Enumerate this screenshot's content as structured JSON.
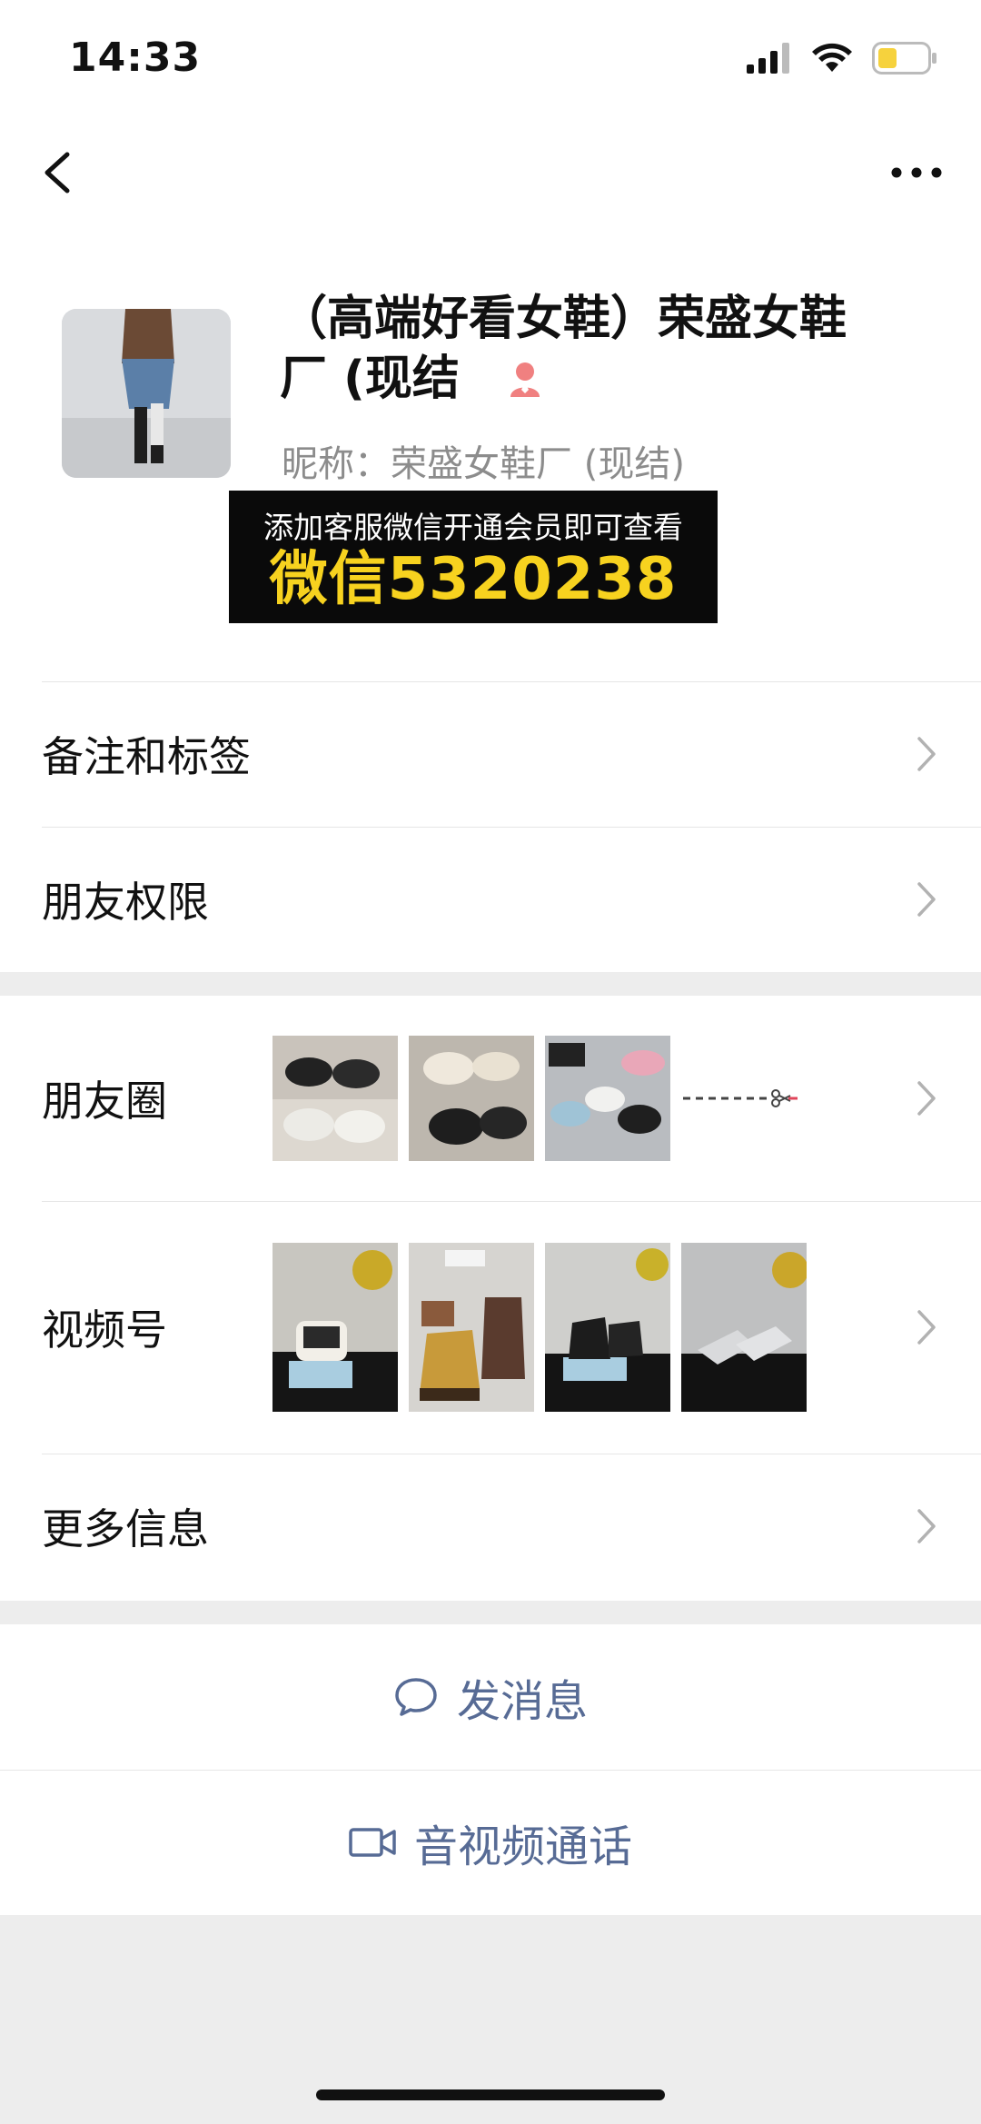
{
  "status_bar": {
    "time": "14:33"
  },
  "profile": {
    "name_line1": "（高端好看女鞋）荣盛女鞋",
    "name_line2": "厂 (现结",
    "nickname": "昵称：荣盛女鞋厂 (现结)"
  },
  "promo": {
    "line1": "添加客服微信开通会员即可查看",
    "line2": "微信5320238"
  },
  "rows": {
    "remarks": "备注和标签",
    "permissions": "朋友权限",
    "moments": "朋友圈",
    "channels": "视频号",
    "more_info": "更多信息"
  },
  "actions": {
    "message": "发消息",
    "call": "音视频通话"
  },
  "colors": {
    "link": "#576b95",
    "promo_yellow": "#f7d21f",
    "background": "#ededed"
  }
}
